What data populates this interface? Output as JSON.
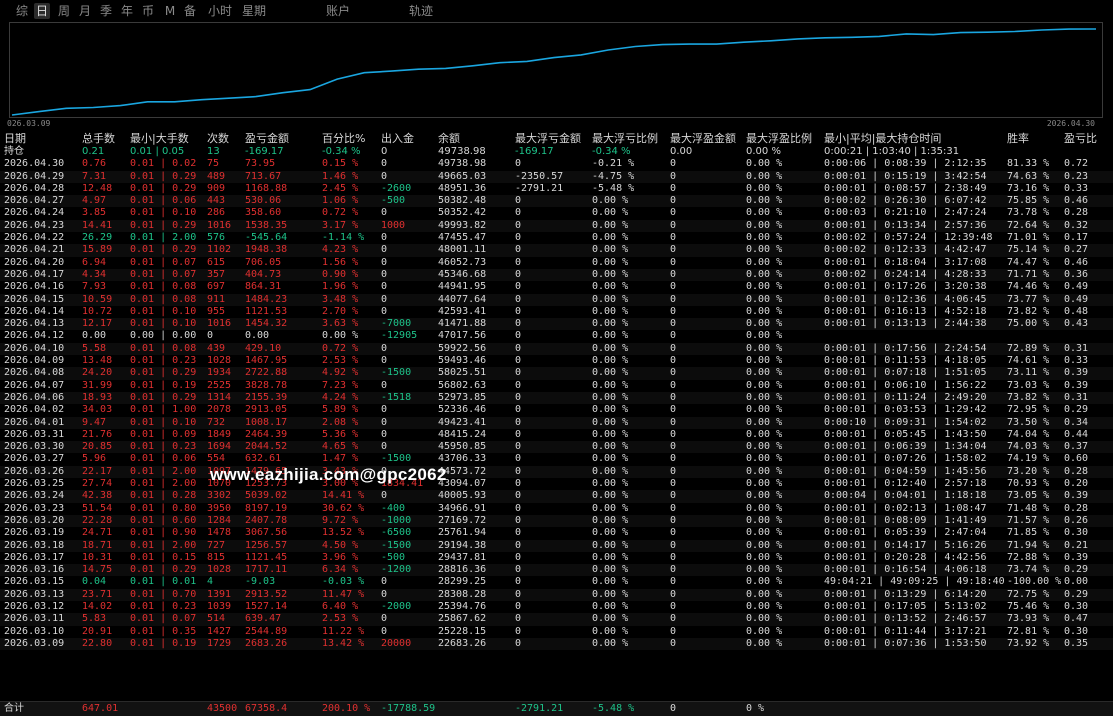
{
  "toolbar": {
    "tabs": [
      "综",
      "日",
      "周",
      "月",
      "季",
      "年",
      "币",
      "M",
      "备",
      "小时",
      "星期",
      "账户",
      "轨迹"
    ],
    "active": "日"
  },
  "chart": {
    "start_date": "026.03.09",
    "end_date": "2026.04.30",
    "line_color": "#1aa6e0"
  },
  "colors": {
    "loss": "#e03030",
    "gain": "#1ec38a",
    "neutral": "#d8d8d8"
  },
  "table": {
    "headers": [
      "日期",
      "总手数",
      "最小|大手数",
      "次数",
      "盈亏金额",
      "百分比%",
      "出入金",
      "余额",
      "最大浮亏金额",
      "最大浮亏比例",
      "最大浮盈金额",
      "最大浮盈比例",
      "最小|平均|最大持仓时间",
      "胜率",
      "盈亏比"
    ],
    "holding": {
      "date": "持仓",
      "lots": "0.21",
      "minmax": "0.01 | 0.05",
      "count": "13",
      "pnl": "-169.17",
      "pct": "-0.34 %",
      "flow": "0",
      "balance": "49738.98",
      "ml": "-169.17",
      "mlp": "-0.34 %",
      "mp": "0.00",
      "mpp": "0.00 %",
      "time": "0:00:21 | 1:03:40 | 1:35:31",
      "win": "",
      "rr": ""
    },
    "rows": [
      {
        "date": "2026.04.30",
        "lots": "0.76",
        "minmax": "0.01 | 0.02",
        "count": "75",
        "pnl": "73.95",
        "pct": "0.15 %",
        "flow": "0",
        "balance": "49738.98",
        "ml": "0",
        "mlp": "-0.21 %",
        "mp": "0",
        "mpp": "0.00 %",
        "time": "0:00:06 | 0:08:39 | 2:12:35",
        "win": "81.33 %",
        "rr": "0.72"
      },
      {
        "date": "2026.04.29",
        "lots": "7.31",
        "minmax": "0.01 | 0.29",
        "count": "489",
        "pnl": "713.67",
        "pct": "1.46 %",
        "flow": "0",
        "balance": "49665.03",
        "ml": "-2350.57",
        "mlp": "-4.75 %",
        "mp": "0",
        "mpp": "0.00 %",
        "time": "0:00:01 | 0:15:19 | 3:42:54",
        "win": "74.63 %",
        "rr": "0.23"
      },
      {
        "date": "2026.04.28",
        "lots": "12.48",
        "minmax": "0.01 | 0.29",
        "count": "909",
        "pnl": "1168.88",
        "pct": "2.45 %",
        "flow": "-2600",
        "balance": "48951.36",
        "ml": "-2791.21",
        "mlp": "-5.48 %",
        "mp": "0",
        "mpp": "0.00 %",
        "time": "0:00:01 | 0:08:57 | 2:38:49",
        "win": "73.16 %",
        "rr": "0.33"
      },
      {
        "date": "2026.04.27",
        "lots": "4.97",
        "minmax": "0.01 | 0.06",
        "count": "443",
        "pnl": "530.06",
        "pct": "1.06 %",
        "flow": "-500",
        "balance": "50382.48",
        "ml": "0",
        "mlp": "0.00 %",
        "mp": "0",
        "mpp": "0.00 %",
        "time": "0:00:02 | 0:26:30 | 6:07:42",
        "win": "75.85 %",
        "rr": "0.46"
      },
      {
        "date": "2026.04.24",
        "lots": "3.85",
        "minmax": "0.01 | 0.10",
        "count": "286",
        "pnl": "358.60",
        "pct": "0.72 %",
        "flow": "0",
        "balance": "50352.42",
        "ml": "0",
        "mlp": "0.00 %",
        "mp": "0",
        "mpp": "0.00 %",
        "time": "0:00:03 | 0:21:10 | 2:47:24",
        "win": "73.78 %",
        "rr": "0.28"
      },
      {
        "date": "2026.04.23",
        "lots": "14.41",
        "minmax": "0.01 | 0.29",
        "count": "1016",
        "pnl": "1538.35",
        "pct": "3.17 %",
        "flow": "1000",
        "balance": "49993.82",
        "ml": "0",
        "mlp": "0.00 %",
        "mp": "0",
        "mpp": "0.00 %",
        "time": "0:00:01 | 0:13:34 | 2:57:36",
        "win": "72.64 %",
        "rr": "0.32"
      },
      {
        "date": "2026.04.22",
        "lots": "26.29",
        "minmax": "0.01 | 2.00",
        "count": "576",
        "pnl": "-545.64",
        "pct": "-1.14 %",
        "flow": "0",
        "balance": "47455.47",
        "ml": "0",
        "mlp": "0.00 %",
        "mp": "0",
        "mpp": "0.00 %",
        "time": "0:00:02 | 0:57:24 | 12:39:48",
        "win": "71.01 %",
        "rr": "0.17"
      },
      {
        "date": "2026.04.21",
        "lots": "15.89",
        "minmax": "0.01 | 0.29",
        "count": "1102",
        "pnl": "1948.38",
        "pct": "4.23 %",
        "flow": "0",
        "balance": "48001.11",
        "ml": "0",
        "mlp": "0.00 %",
        "mp": "0",
        "mpp": "0.00 %",
        "time": "0:00:02 | 0:12:33 | 4:42:47",
        "win": "75.14 %",
        "rr": "0.27"
      },
      {
        "date": "2026.04.20",
        "lots": "6.94",
        "minmax": "0.01 | 0.07",
        "count": "615",
        "pnl": "706.05",
        "pct": "1.56 %",
        "flow": "0",
        "balance": "46052.73",
        "ml": "0",
        "mlp": "0.00 %",
        "mp": "0",
        "mpp": "0.00 %",
        "time": "0:00:01 | 0:18:04 | 3:17:08",
        "win": "74.47 %",
        "rr": "0.46"
      },
      {
        "date": "2026.04.17",
        "lots": "4.34",
        "minmax": "0.01 | 0.07",
        "count": "357",
        "pnl": "404.73",
        "pct": "0.90 %",
        "flow": "0",
        "balance": "45346.68",
        "ml": "0",
        "mlp": "0.00 %",
        "mp": "0",
        "mpp": "0.00 %",
        "time": "0:00:02 | 0:24:14 | 4:28:33",
        "win": "71.71 %",
        "rr": "0.36"
      },
      {
        "date": "2026.04.16",
        "lots": "7.93",
        "minmax": "0.01 | 0.08",
        "count": "697",
        "pnl": "864.31",
        "pct": "1.96 %",
        "flow": "0",
        "balance": "44941.95",
        "ml": "0",
        "mlp": "0.00 %",
        "mp": "0",
        "mpp": "0.00 %",
        "time": "0:00:01 | 0:17:26 | 3:20:38",
        "win": "74.46 %",
        "rr": "0.49"
      },
      {
        "date": "2026.04.15",
        "lots": "10.59",
        "minmax": "0.01 | 0.08",
        "count": "911",
        "pnl": "1484.23",
        "pct": "3.48 %",
        "flow": "0",
        "balance": "44077.64",
        "ml": "0",
        "mlp": "0.00 %",
        "mp": "0",
        "mpp": "0.00 %",
        "time": "0:00:01 | 0:12:36 | 4:06:45",
        "win": "73.77 %",
        "rr": "0.49"
      },
      {
        "date": "2026.04.14",
        "lots": "10.72",
        "minmax": "0.01 | 0.10",
        "count": "955",
        "pnl": "1121.53",
        "pct": "2.70 %",
        "flow": "0",
        "balance": "42593.41",
        "ml": "0",
        "mlp": "0.00 %",
        "mp": "0",
        "mpp": "0.00 %",
        "time": "0:00:01 | 0:16:13 | 4:52:18",
        "win": "73.82 %",
        "rr": "0.48"
      },
      {
        "date": "2026.04.13",
        "lots": "12.17",
        "minmax": "0.01 | 0.10",
        "count": "1016",
        "pnl": "1454.32",
        "pct": "3.63 %",
        "flow": "-7000",
        "balance": "41471.88",
        "ml": "0",
        "mlp": "0.00 %",
        "mp": "0",
        "mpp": "0.00 %",
        "time": "0:00:01 | 0:13:13 | 2:44:38",
        "win": "75.00 %",
        "rr": "0.43"
      },
      {
        "date": "2026.04.12",
        "lots": "0.00",
        "minmax": "0.00 | 0.00",
        "count": "0",
        "pnl": "0.00",
        "pct": "0.00 %",
        "flow": "-12905",
        "balance": "47017.56",
        "ml": "0",
        "mlp": "0.00 %",
        "mp": "0",
        "mpp": "0.00 %",
        "time": "",
        "win": "",
        "rr": ""
      },
      {
        "date": "2026.04.10",
        "lots": "5.58",
        "minmax": "0.01 | 0.08",
        "count": "439",
        "pnl": "429.10",
        "pct": "0.72 %",
        "flow": "0",
        "balance": "59922.56",
        "ml": "0",
        "mlp": "0.00 %",
        "mp": "0",
        "mpp": "0.00 %",
        "time": "0:00:01 | 0:17:56 | 2:24:54",
        "win": "72.89 %",
        "rr": "0.31"
      },
      {
        "date": "2026.04.09",
        "lots": "13.48",
        "minmax": "0.01 | 0.23",
        "count": "1028",
        "pnl": "1467.95",
        "pct": "2.53 %",
        "flow": "0",
        "balance": "59493.46",
        "ml": "0",
        "mlp": "0.00 %",
        "mp": "0",
        "mpp": "0.00 %",
        "time": "0:00:01 | 0:11:53 | 4:18:05",
        "win": "74.61 %",
        "rr": "0.33"
      },
      {
        "date": "2026.04.08",
        "lots": "24.20",
        "minmax": "0.01 | 0.29",
        "count": "1934",
        "pnl": "2722.88",
        "pct": "4.92 %",
        "flow": "-1500",
        "balance": "58025.51",
        "ml": "0",
        "mlp": "0.00 %",
        "mp": "0",
        "mpp": "0.00 %",
        "time": "0:00:01 | 0:07:18 | 1:51:05",
        "win": "73.11 %",
        "rr": "0.39"
      },
      {
        "date": "2026.04.07",
        "lots": "31.99",
        "minmax": "0.01 | 0.19",
        "count": "2525",
        "pnl": "3828.78",
        "pct": "7.23 %",
        "flow": "0",
        "balance": "56802.63",
        "ml": "0",
        "mlp": "0.00 %",
        "mp": "0",
        "mpp": "0.00 %",
        "time": "0:00:01 | 0:06:10 | 1:56:22",
        "win": "73.03 %",
        "rr": "0.39"
      },
      {
        "date": "2026.04.06",
        "lots": "18.93",
        "minmax": "0.01 | 0.29",
        "count": "1314",
        "pnl": "2155.39",
        "pct": "4.24 %",
        "flow": "-1518",
        "balance": "52973.85",
        "ml": "0",
        "mlp": "0.00 %",
        "mp": "0",
        "mpp": "0.00 %",
        "time": "0:00:01 | 0:11:24 | 2:49:20",
        "win": "73.82 %",
        "rr": "0.31"
      },
      {
        "date": "2026.04.02",
        "lots": "34.03",
        "minmax": "0.01 | 1.00",
        "count": "2078",
        "pnl": "2913.05",
        "pct": "5.89 %",
        "flow": "0",
        "balance": "52336.46",
        "ml": "0",
        "mlp": "0.00 %",
        "mp": "0",
        "mpp": "0.00 %",
        "time": "0:00:01 | 0:03:53 | 1:29:42",
        "win": "72.95 %",
        "rr": "0.29"
      },
      {
        "date": "2026.04.01",
        "lots": "9.47",
        "minmax": "0.01 | 0.10",
        "count": "732",
        "pnl": "1008.17",
        "pct": "2.08 %",
        "flow": "0",
        "balance": "49423.41",
        "ml": "0",
        "mlp": "0.00 %",
        "mp": "0",
        "mpp": "0.00 %",
        "time": "0:00:10 | 0:09:31 | 1:54:02",
        "win": "73.50 %",
        "rr": "0.34"
      },
      {
        "date": "2026.03.31",
        "lots": "21.76",
        "minmax": "0.01 | 0.09",
        "count": "1849",
        "pnl": "2464.39",
        "pct": "5.36 %",
        "flow": "0",
        "balance": "48415.24",
        "ml": "0",
        "mlp": "0.00 %",
        "mp": "0",
        "mpp": "0.00 %",
        "time": "0:00:01 | 0:05:45 | 1:43:50",
        "win": "74.04 %",
        "rr": "0.44"
      },
      {
        "date": "2026.03.30",
        "lots": "20.85",
        "minmax": "0.01 | 0.23",
        "count": "1694",
        "pnl": "2044.52",
        "pct": "4.65 %",
        "flow": "0",
        "balance": "45950.85",
        "ml": "0",
        "mlp": "0.00 %",
        "mp": "0",
        "mpp": "0.00 %",
        "time": "0:00:01 | 0:06:39 | 1:34:04",
        "win": "74.03 %",
        "rr": "0.37"
      },
      {
        "date": "2026.03.27",
        "lots": "5.96",
        "minmax": "0.01 | 0.06",
        "count": "554",
        "pnl": "632.61",
        "pct": "1.47 %",
        "flow": "-1500",
        "balance": "43706.33",
        "ml": "0",
        "mlp": "0.00 %",
        "mp": "0",
        "mpp": "0.00 %",
        "time": "0:00:01 | 0:07:26 | 1:58:02",
        "win": "74.19 %",
        "rr": "0.60"
      },
      {
        "date": "2026.03.26",
        "lots": "22.17",
        "minmax": "0.01 | 2.00",
        "count": "1097",
        "pnl": "1479.65",
        "pct": "3.43 %",
        "flow": "0",
        "balance": "44573.72",
        "ml": "0",
        "mlp": "0.00 %",
        "mp": "0",
        "mpp": "0.00 %",
        "time": "0:00:01 | 0:04:59 | 1:45:56",
        "win": "73.20 %",
        "rr": "0.28"
      },
      {
        "date": "2026.03.25",
        "lots": "27.74",
        "minmax": "0.01 | 2.00",
        "count": "1070",
        "pnl": "1253.73",
        "pct": "3.00 %",
        "flow": "1834.41",
        "balance": "43094.07",
        "ml": "0",
        "mlp": "0.00 %",
        "mp": "0",
        "mpp": "0.00 %",
        "time": "0:00:01 | 0:12:40 | 2:57:18",
        "win": "70.93 %",
        "rr": "0.20"
      },
      {
        "date": "2026.03.24",
        "lots": "42.38",
        "minmax": "0.01 | 0.28",
        "count": "3302",
        "pnl": "5039.02",
        "pct": "14.41 %",
        "flow": "0",
        "balance": "40005.93",
        "ml": "0",
        "mlp": "0.00 %",
        "mp": "0",
        "mpp": "0.00 %",
        "time": "0:00:04 | 0:04:01 | 1:18:18",
        "win": "73.05 %",
        "rr": "0.39"
      },
      {
        "date": "2026.03.23",
        "lots": "51.54",
        "minmax": "0.01 | 0.80",
        "count": "3950",
        "pnl": "8197.19",
        "pct": "30.62 %",
        "flow": "-400",
        "balance": "34966.91",
        "ml": "0",
        "mlp": "0.00 %",
        "mp": "0",
        "mpp": "0.00 %",
        "time": "0:00:01 | 0:02:13 | 1:08:47",
        "win": "71.48 %",
        "rr": "0.28"
      },
      {
        "date": "2026.03.20",
        "lots": "22.28",
        "minmax": "0.01 | 0.60",
        "count": "1284",
        "pnl": "2407.78",
        "pct": "9.72 %",
        "flow": "-1000",
        "balance": "27169.72",
        "ml": "0",
        "mlp": "0.00 %",
        "mp": "0",
        "mpp": "0.00 %",
        "time": "0:00:01 | 0:08:09 | 1:41:49",
        "win": "71.57 %",
        "rr": "0.26"
      },
      {
        "date": "2026.03.19",
        "lots": "24.71",
        "minmax": "0.01 | 0.90",
        "count": "1478",
        "pnl": "3067.56",
        "pct": "13.52 %",
        "flow": "-6500",
        "balance": "25761.94",
        "ml": "0",
        "mlp": "0.00 %",
        "mp": "0",
        "mpp": "0.00 %",
        "time": "0:00:01 | 0:05:39 | 2:47:04",
        "win": "71.85 %",
        "rr": "0.30"
      },
      {
        "date": "2026.03.18",
        "lots": "18.71",
        "minmax": "0.01 | 2.00",
        "count": "727",
        "pnl": "1256.57",
        "pct": "4.50 %",
        "flow": "-1500",
        "balance": "29194.38",
        "ml": "0",
        "mlp": "0.00 %",
        "mp": "0",
        "mpp": "0.00 %",
        "time": "0:00:01 | 0:14:17 | 5:16:26",
        "win": "71.94 %",
        "rr": "0.21"
      },
      {
        "date": "2026.03.17",
        "lots": "10.31",
        "minmax": "0.01 | 0.15",
        "count": "815",
        "pnl": "1121.45",
        "pct": "3.96 %",
        "flow": "-500",
        "balance": "29437.81",
        "ml": "0",
        "mlp": "0.00 %",
        "mp": "0",
        "mpp": "0.00 %",
        "time": "0:00:01 | 0:20:28 | 4:42:56",
        "win": "72.88 %",
        "rr": "0.39"
      },
      {
        "date": "2026.03.16",
        "lots": "14.75",
        "minmax": "0.01 | 0.29",
        "count": "1028",
        "pnl": "1717.11",
        "pct": "6.34 %",
        "flow": "-1200",
        "balance": "28816.36",
        "ml": "0",
        "mlp": "0.00 %",
        "mp": "0",
        "mpp": "0.00 %",
        "time": "0:00:01 | 0:16:54 | 4:06:18",
        "win": "73.74 %",
        "rr": "0.29"
      },
      {
        "date": "2026.03.15",
        "lots": "0.04",
        "minmax": "0.01 | 0.01",
        "count": "4",
        "pnl": "-9.03",
        "pct": "-0.03 %",
        "flow": "0",
        "balance": "28299.25",
        "ml": "0",
        "mlp": "0.00 %",
        "mp": "0",
        "mpp": "0.00 %",
        "time": "49:04:21 | 49:09:25 | 49:18:40",
        "win": "-100.00 %",
        "rr": "0.00"
      },
      {
        "date": "2026.03.13",
        "lots": "23.71",
        "minmax": "0.01 | 0.70",
        "count": "1391",
        "pnl": "2913.52",
        "pct": "11.47 %",
        "flow": "0",
        "balance": "28308.28",
        "ml": "0",
        "mlp": "0.00 %",
        "mp": "0",
        "mpp": "0.00 %",
        "time": "0:00:01 | 0:13:29 | 6:14:20",
        "win": "72.75 %",
        "rr": "0.29"
      },
      {
        "date": "2026.03.12",
        "lots": "14.02",
        "minmax": "0.01 | 0.23",
        "count": "1039",
        "pnl": "1527.14",
        "pct": "6.40 %",
        "flow": "-2000",
        "balance": "25394.76",
        "ml": "0",
        "mlp": "0.00 %",
        "mp": "0",
        "mpp": "0.00 %",
        "time": "0:00:01 | 0:17:05 | 5:13:02",
        "win": "75.46 %",
        "rr": "0.30"
      },
      {
        "date": "2026.03.11",
        "lots": "5.83",
        "minmax": "0.01 | 0.07",
        "count": "514",
        "pnl": "639.47",
        "pct": "2.53 %",
        "flow": "0",
        "balance": "25867.62",
        "ml": "0",
        "mlp": "0.00 %",
        "mp": "0",
        "mpp": "0.00 %",
        "time": "0:00:01 | 0:13:52 | 2:46:57",
        "win": "73.93 %",
        "rr": "0.47"
      },
      {
        "date": "2026.03.10",
        "lots": "20.91",
        "minmax": "0.01 | 0.35",
        "count": "1427",
        "pnl": "2544.89",
        "pct": "11.22 %",
        "flow": "0",
        "balance": "25228.15",
        "ml": "0",
        "mlp": "0.00 %",
        "mp": "0",
        "mpp": "0.00 %",
        "time": "0:00:01 | 0:11:44 | 3:17:21",
        "win": "72.81 %",
        "rr": "0.30"
      },
      {
        "date": "2026.03.09",
        "lots": "22.80",
        "minmax": "0.01 | 0.19",
        "count": "1729",
        "pnl": "2683.26",
        "pct": "13.42 %",
        "flow": "20000",
        "balance": "22683.26",
        "ml": "0",
        "mlp": "0.00 %",
        "mp": "0",
        "mpp": "0.00 %",
        "time": "0:00:01 | 0:07:36 | 1:53:50",
        "win": "73.92 %",
        "rr": "0.35"
      }
    ],
    "total": {
      "label": "合计",
      "lots": "647.01",
      "count": "43500",
      "pnl": "67358.4",
      "pct": "200.10 %",
      "flow": "-17788.59",
      "ml": "-2791.21",
      "mlp": "-5.48 %",
      "mp": "0",
      "mpp": "0 %"
    }
  },
  "watermark": "www.eazhijia.com@gpc2062"
}
